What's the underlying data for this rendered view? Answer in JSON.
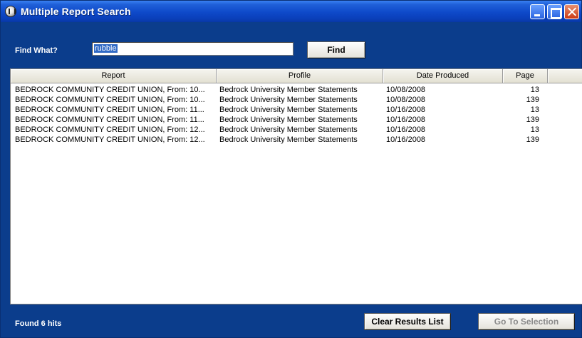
{
  "window": {
    "title": "Multiple Report Search"
  },
  "search": {
    "label": "Find What?",
    "value": "rubble",
    "find_button": "Find"
  },
  "results": {
    "columns": [
      "Report",
      "Profile",
      "Date Produced",
      "Page",
      ""
    ],
    "rows": [
      {
        "report": "BEDROCK COMMUNITY CREDIT UNION, From:  10...",
        "profile": "Bedrock University Member Statements",
        "date": "10/08/2008",
        "page": "13"
      },
      {
        "report": "BEDROCK COMMUNITY CREDIT UNION, From:  10...",
        "profile": "Bedrock University Member Statements",
        "date": "10/08/2008",
        "page": "139"
      },
      {
        "report": "BEDROCK COMMUNITY CREDIT UNION, From:  11...",
        "profile": "Bedrock University Member Statements",
        "date": "10/16/2008",
        "page": "13"
      },
      {
        "report": "BEDROCK COMMUNITY CREDIT UNION, From:  11...",
        "profile": "Bedrock University Member Statements",
        "date": "10/16/2008",
        "page": "139"
      },
      {
        "report": "BEDROCK COMMUNITY CREDIT UNION, From:  12...",
        "profile": "Bedrock University Member Statements",
        "date": "10/16/2008",
        "page": "13"
      },
      {
        "report": "BEDROCK COMMUNITY CREDIT UNION, From:  12...",
        "profile": "Bedrock University Member Statements",
        "date": "10/16/2008",
        "page": "139"
      }
    ]
  },
  "footer": {
    "status": "Found 6 hits",
    "clear_button": "Clear Results List",
    "goto_button": "Go To Selection"
  },
  "icons": {
    "app": "app-icon",
    "minimize": "minimize-icon",
    "maximize": "maximize-icon",
    "close": "close-icon"
  },
  "colors": {
    "window_bg": "#0b3d8c",
    "titlebar": "#0e49c9",
    "selection": "#316ac5",
    "disabled_text": "#8a8a8a"
  }
}
